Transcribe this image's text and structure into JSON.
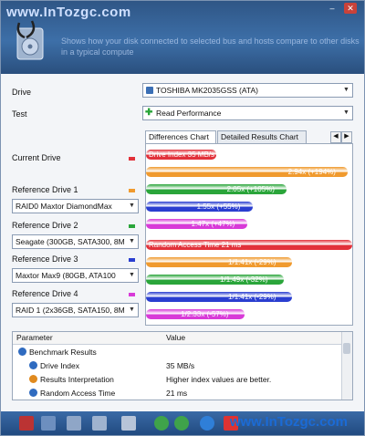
{
  "watermark_top": "www.InTozgc.com",
  "watermark_bottom": "www.InTozgc.com",
  "description": "Shows how your disk connected to selected bus and hosts compare to other disks in a typical compute",
  "drive": {
    "label": "Drive",
    "value": "TOSHIBA MK2035GSS (ATA)"
  },
  "test": {
    "label": "Test",
    "value": "Read Performance"
  },
  "tabs": {
    "active": "Differences Chart",
    "other": "Detailed Results Chart"
  },
  "current_drive": {
    "label": "Current Drive",
    "color": "#e2313a"
  },
  "refs": [
    {
      "label": "Reference Drive 1",
      "value": "RAID0 Maxtor DiamondMax",
      "color": "#f09a2e"
    },
    {
      "label": "Reference Drive 2",
      "value": "Seagate (300GB, SATA300, 8M",
      "color": "#2aa53a"
    },
    {
      "label": "Reference Drive 3",
      "value": "Maxtor Max9 (80GB, ATA100",
      "color": "#2a3ed0"
    },
    {
      "label": "Reference Drive 4",
      "value": "RAID 1 (2x36GB, SATA150, 8M",
      "color": "#d83ad8"
    }
  ],
  "chart_data": {
    "type": "bar",
    "groups": [
      {
        "name": "Drive Index 35 MB/s",
        "bars": [
          {
            "value": 1.0,
            "label": "",
            "color": "#e2313a"
          },
          {
            "value": 2.94,
            "label": "2.94x (+194%)",
            "color": "#f09a2e"
          },
          {
            "value": 2.05,
            "label": "2.05x (+105%)",
            "color": "#2aa53a"
          },
          {
            "value": 1.55,
            "label": "1.55x (+55%)",
            "color": "#2a3ed0"
          },
          {
            "value": 1.47,
            "label": "1.47x (+47%)",
            "color": "#d83ad8"
          }
        ]
      },
      {
        "name": "Random Access Time 21 ms",
        "bars": [
          {
            "value": 1.0,
            "label": "",
            "color": "#e2313a"
          },
          {
            "value": 0.71,
            "label": "1/1.41x (-29%)",
            "color": "#f09a2e"
          },
          {
            "value": 0.67,
            "label": "1/1.49x (-32%)",
            "color": "#2aa53a"
          },
          {
            "value": 0.71,
            "label": "1/1.41x (-29%)",
            "color": "#2a3ed0"
          },
          {
            "value": 0.48,
            "label": "1/2.33x (-57%)",
            "color": "#d83ad8"
          }
        ]
      }
    ]
  },
  "table": {
    "col_param": "Parameter",
    "col_value": "Value",
    "rows": [
      {
        "param": "Benchmark Results",
        "value": "",
        "icon": "benchmark-icon",
        "indent": 0
      },
      {
        "param": "Drive Index",
        "value": "35 MB/s",
        "icon": "drive-index-icon",
        "indent": 1
      },
      {
        "param": "Results Interpretation",
        "value": "Higher index values are better.",
        "icon": "interpretation-icon",
        "indent": 1
      },
      {
        "param": "Random Access Time",
        "value": "21 ms",
        "icon": "access-time-icon",
        "indent": 1
      }
    ]
  }
}
